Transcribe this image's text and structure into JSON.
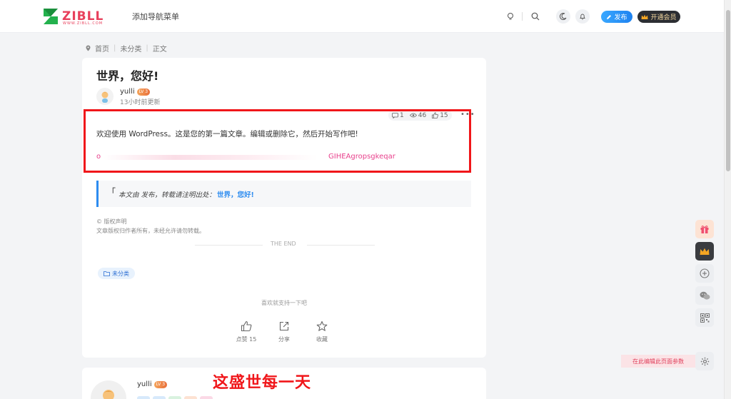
{
  "brand": {
    "logo_text": "ZIBLL",
    "logo_sub": "WWW.ZIBLL.COM"
  },
  "header": {
    "nav_add": "添加导航菜单",
    "publish_label": "发布",
    "vip_label": "开通会员"
  },
  "breadcrumb": {
    "home": "首页",
    "category": "未分类",
    "current": "正文"
  },
  "article": {
    "title": "世界，您好!",
    "author": "yulli",
    "level": "LV 3",
    "updated": "13小时前更新",
    "stats": {
      "comments": "1",
      "views": "46",
      "likes": "15"
    },
    "more": "•••",
    "body": "欢迎使用 WordPress。这是您的第一篇文章。编辑或删除它，然后开始写作吧!",
    "pink_start": "o",
    "pink_end": "GIHEAgropsgkeqar",
    "quote_open": "「",
    "quote_prefix": "本文由 发布，转载请注明出处：",
    "quote_link": "世界，您好!",
    "copyright_title": "© 版权声明",
    "copyright_text": "文章版权归作者所有，未经允许请勿转载。",
    "the_end": "THE END",
    "tag": "未分类",
    "support": "喜欢就支持一下吧",
    "actions": [
      {
        "label": "点赞 15"
      },
      {
        "label": "分享"
      },
      {
        "label": "收藏"
      }
    ]
  },
  "author_card": {
    "name": "yulli",
    "level": "LV 3"
  },
  "overlay": {
    "text": "这盛世每一天"
  },
  "sidebar": {
    "edit_hint": "在此编辑此页面参数"
  },
  "colors": {
    "accent": "#2d8cf0",
    "highlight_red": "#f0161a",
    "pink": "#e8408c",
    "vip_gold": "#f5d9a0"
  }
}
